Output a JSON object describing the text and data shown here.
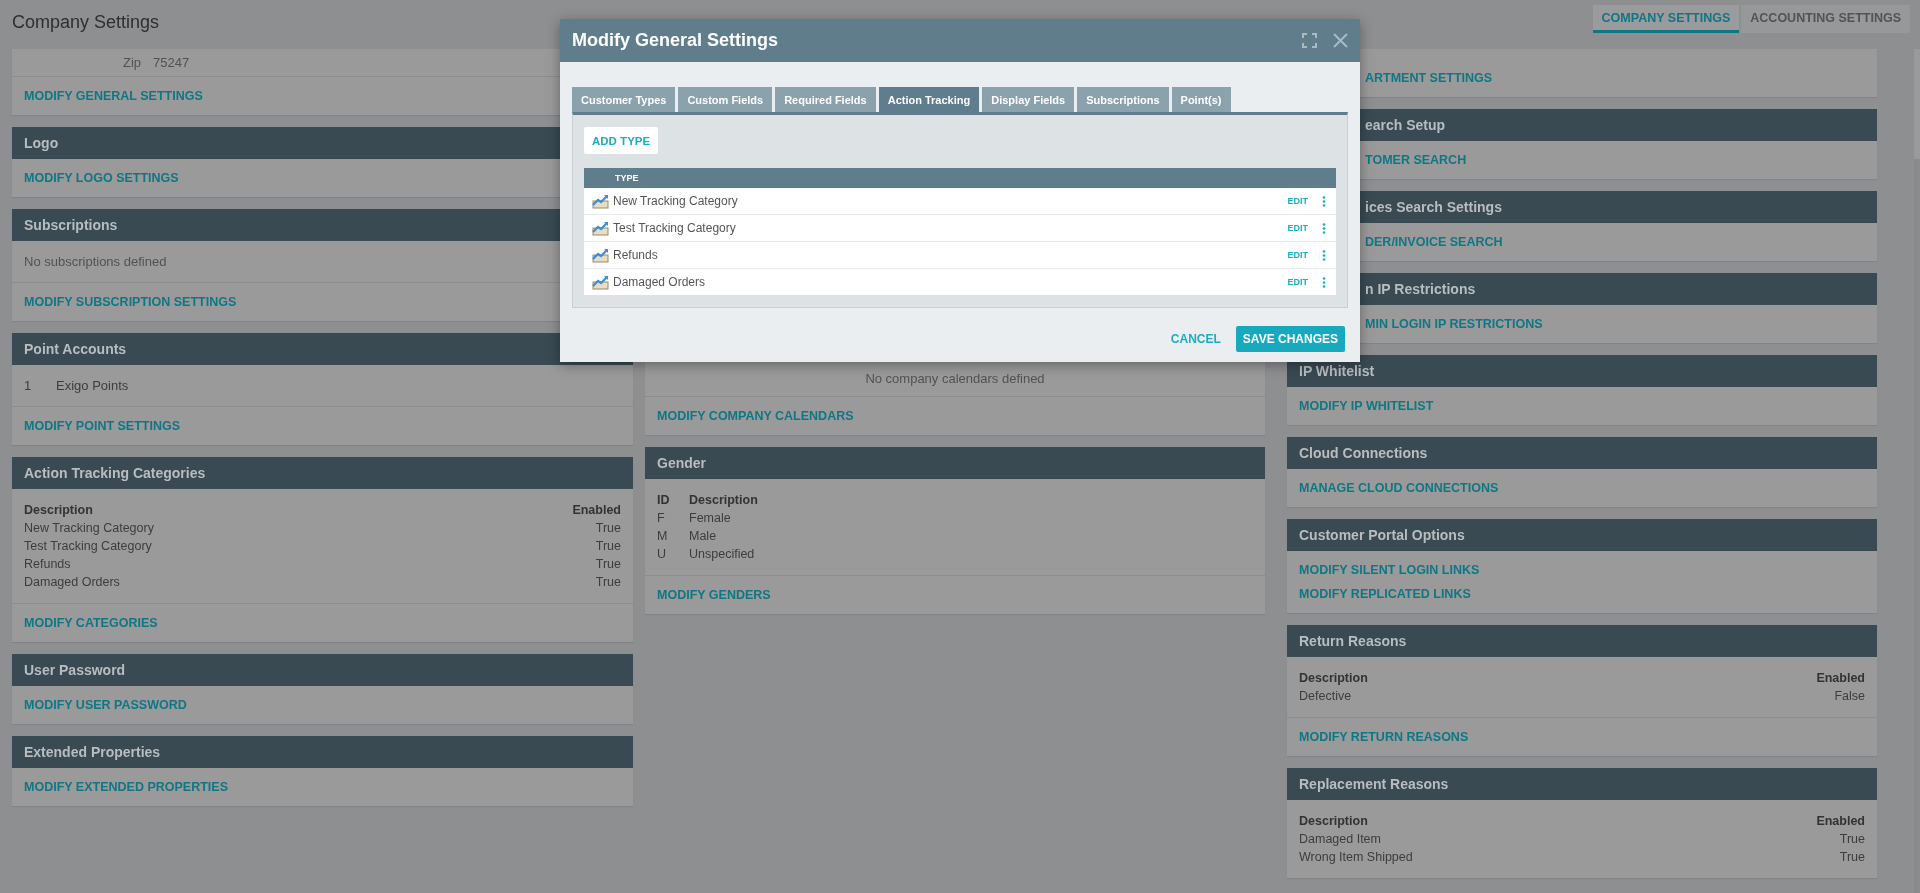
{
  "page": {
    "title": "Company Settings"
  },
  "top_tabs": [
    {
      "label": "COMPANY SETTINGS",
      "selected": true
    },
    {
      "label": "ACCOUNTING SETTINGS",
      "selected": false
    }
  ],
  "columns": [
    [
      {
        "sections": [
          {
            "kind": "field",
            "label": "Zip",
            "value": "75247"
          },
          {
            "kind": "links",
            "links": [
              "MODIFY GENERAL SETTINGS"
            ]
          }
        ]
      },
      {
        "header": "Logo",
        "sections": [
          {
            "kind": "links",
            "links": [
              "MODIFY LOGO SETTINGS"
            ]
          }
        ]
      },
      {
        "header": "Subscriptions",
        "sections": [
          {
            "kind": "note",
            "text": "No subscriptions defined"
          },
          {
            "kind": "links",
            "links": [
              "MODIFY SUBSCRIPTION SETTINGS"
            ]
          }
        ]
      },
      {
        "header": "Point Accounts",
        "sections": [
          {
            "kind": "list",
            "rows": [
              [
                "1",
                "Exigo Points"
              ]
            ]
          },
          {
            "kind": "links",
            "links": [
              "MODIFY POINT SETTINGS"
            ]
          }
        ]
      },
      {
        "header": "Action Tracking Categories",
        "sections": [
          {
            "kind": "table",
            "columns": [
              "Description",
              "Enabled"
            ],
            "rows": [
              [
                "New Tracking Category",
                "True"
              ],
              [
                "Test Tracking Category",
                "True"
              ],
              [
                "Refunds",
                "True"
              ],
              [
                "Damaged Orders",
                "True"
              ]
            ]
          },
          {
            "kind": "links",
            "links": [
              "MODIFY CATEGORIES"
            ]
          }
        ]
      },
      {
        "header": "User Password",
        "sections": [
          {
            "kind": "links",
            "links": [
              "MODIFY USER PASSWORD"
            ]
          }
        ]
      },
      {
        "header": "Extended Properties",
        "sections": [
          {
            "kind": "links",
            "links": [
              "MODIFY EXTENDED PROPERTIES"
            ]
          }
        ]
      }
    ],
    [
      {
        "covered": true,
        "sections": [
          {
            "kind": "centered_note",
            "text": "No company calendars defined"
          },
          {
            "kind": "links",
            "links": [
              "MODIFY COMPANY CALENDARS"
            ]
          }
        ]
      },
      {
        "header": "Gender",
        "sections": [
          {
            "kind": "id_table",
            "columns": [
              "ID",
              "Description"
            ],
            "rows": [
              [
                "F",
                "Female"
              ],
              [
                "M",
                "Male"
              ],
              [
                "U",
                "Unspecified"
              ]
            ]
          },
          {
            "kind": "links",
            "links": [
              "MODIFY GENDERS"
            ]
          }
        ]
      }
    ],
    [
      {
        "covered": true,
        "sections": [
          {
            "kind": "links",
            "links": [
              "ARTMENT SETTINGS"
            ]
          }
        ]
      },
      {
        "covered": true,
        "header": "earch Setup",
        "sections": [
          {
            "kind": "links",
            "links": [
              "TOMER SEARCH"
            ]
          }
        ]
      },
      {
        "covered": true,
        "header": "ices Search Settings",
        "sections": [
          {
            "kind": "links",
            "links": [
              "DER/INVOICE SEARCH"
            ]
          }
        ]
      },
      {
        "covered": true,
        "header": "n IP Restrictions",
        "sections": [
          {
            "kind": "links",
            "links": [
              "MIN LOGIN IP RESTRICTIONS"
            ]
          }
        ]
      },
      {
        "header": "IP Whitelist",
        "sections": [
          {
            "kind": "links",
            "links": [
              "MODIFY IP WHITELIST"
            ]
          }
        ]
      },
      {
        "header": "Cloud Connections",
        "sections": [
          {
            "kind": "links",
            "links": [
              "MANAGE CLOUD CONNECTIONS"
            ]
          }
        ]
      },
      {
        "header": "Customer Portal Options",
        "sections": [
          {
            "kind": "links",
            "links": [
              "MODIFY SILENT LOGIN LINKS",
              "MODIFY REPLICATED LINKS"
            ]
          }
        ]
      },
      {
        "header": "Return Reasons",
        "sections": [
          {
            "kind": "table",
            "columns": [
              "Description",
              "Enabled"
            ],
            "rows": [
              [
                "Defective",
                "False"
              ]
            ]
          },
          {
            "kind": "links",
            "links": [
              "MODIFY RETURN REASONS"
            ]
          }
        ]
      },
      {
        "header": "Replacement Reasons",
        "sections": [
          {
            "kind": "table",
            "columns": [
              "Description",
              "Enabled"
            ],
            "rows": [
              [
                "Damaged Item",
                "True"
              ],
              [
                "Wrong Item Shipped",
                "True"
              ]
            ]
          }
        ]
      }
    ]
  ],
  "modal": {
    "title": "Modify General Settings",
    "tabs": [
      {
        "label": "Customer Types",
        "selected": false
      },
      {
        "label": "Custom Fields",
        "selected": false
      },
      {
        "label": "Required Fields",
        "selected": false
      },
      {
        "label": "Action Tracking",
        "selected": true
      },
      {
        "label": "Display Fields",
        "selected": false
      },
      {
        "label": "Subscriptions",
        "selected": false
      },
      {
        "label": "Point(s)",
        "selected": false
      }
    ],
    "add_button": "ADD TYPE",
    "table": {
      "columns": [
        "TYPE"
      ],
      "rows": [
        {
          "type": "New Tracking Category",
          "action": "EDIT"
        },
        {
          "type": "Test Tracking Category",
          "action": "EDIT"
        },
        {
          "type": "Refunds",
          "action": "EDIT"
        },
        {
          "type": "Damaged Orders",
          "action": "EDIT"
        }
      ]
    },
    "buttons": [
      {
        "label": "CANCEL",
        "kind": "flat"
      },
      {
        "label": "SAVE CHANGES",
        "kind": "primary"
      }
    ]
  }
}
